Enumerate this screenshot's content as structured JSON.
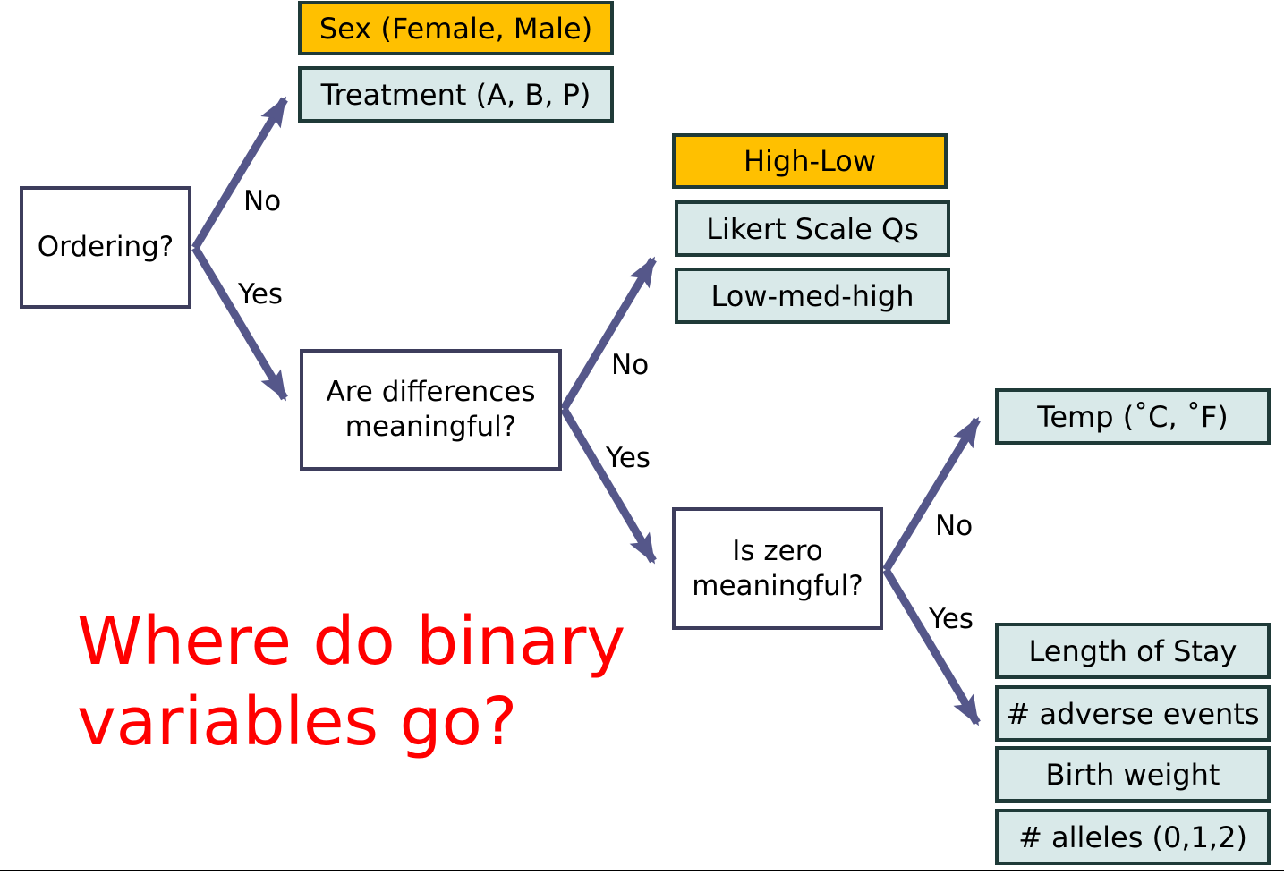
{
  "questions": {
    "ordering": "Ordering?",
    "differences_line1": "Are differences",
    "differences_line2": "meaningful?",
    "zero_line1": "Is zero",
    "zero_line2": "meaningful?"
  },
  "branches": {
    "no": "No",
    "yes": "Yes"
  },
  "nominal_examples": [
    "Sex (Female, Male)",
    "Treatment (A, B, P)"
  ],
  "ordinal_examples": [
    "High-Low",
    "Likert Scale Qs",
    "Low-med-high"
  ],
  "interval_examples": [
    "Temp (˚C, ˚F)"
  ],
  "ratio_examples": [
    "Length of Stay",
    "# adverse events",
    "Birth weight",
    "# alleles (0,1,2)"
  ],
  "prompt": {
    "line1": "Where do binary",
    "line2": "variables go?"
  },
  "colors": {
    "arrow": "#55578a",
    "highlight": "#ffc000",
    "example_fill": "#d9e9e9",
    "prompt_text": "#ff0000"
  }
}
